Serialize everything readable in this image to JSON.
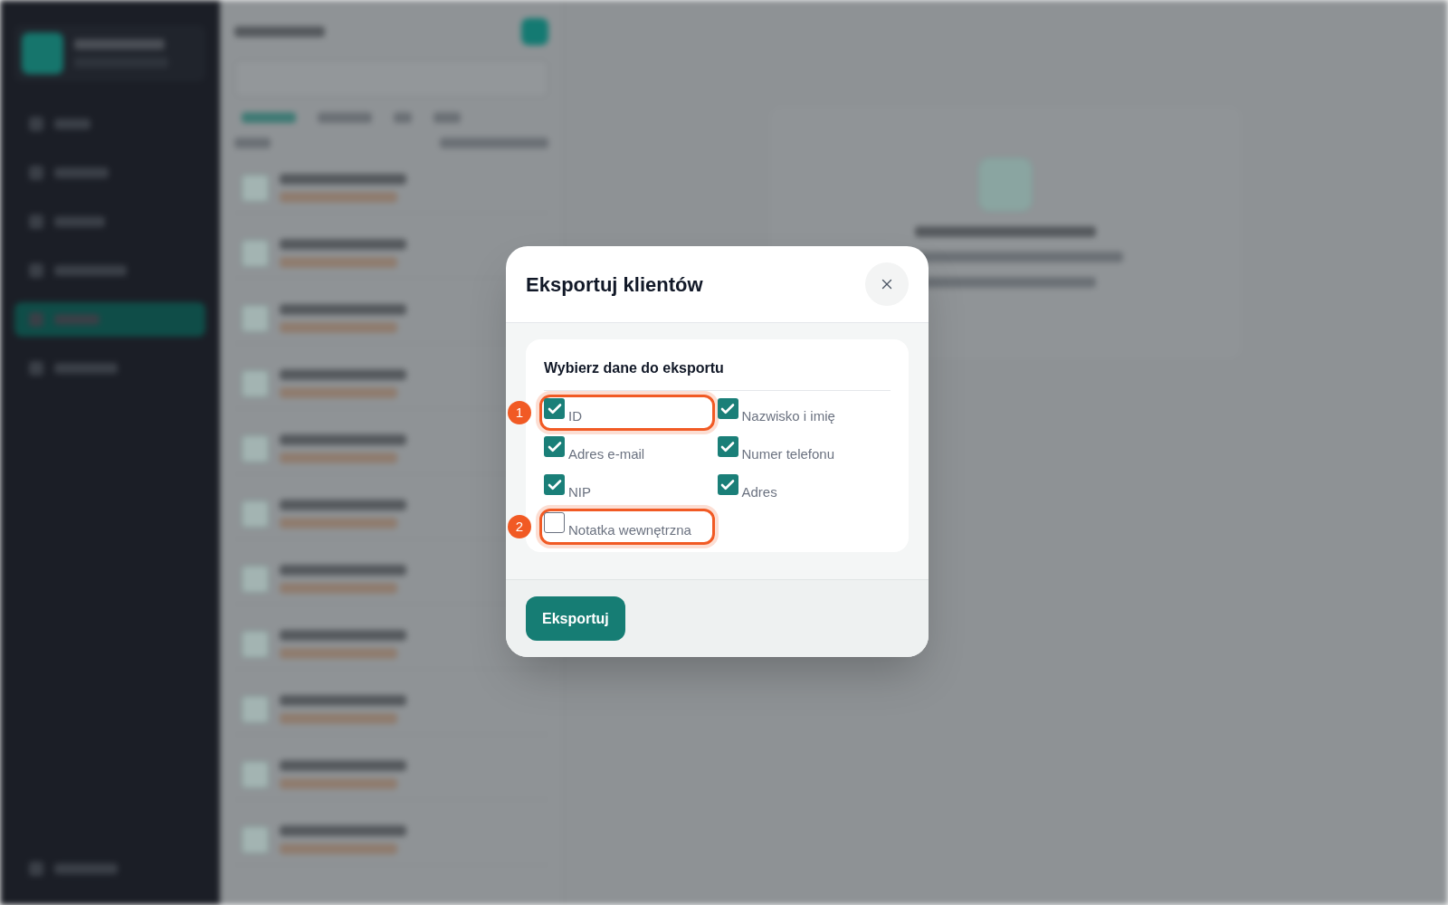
{
  "dialog": {
    "title": "Eksportuj klientów",
    "section_title": "Wybierz dane do eksportu",
    "options": [
      {
        "label": "ID",
        "checked": true,
        "marker": "1"
      },
      {
        "label": "Nazwisko i imię",
        "checked": true
      },
      {
        "label": "Adres e-mail",
        "checked": true
      },
      {
        "label": "Numer telefonu",
        "checked": true
      },
      {
        "label": "NIP",
        "checked": true
      },
      {
        "label": "Adres",
        "checked": true
      },
      {
        "label": "Notatka wewnętrzna",
        "checked": false,
        "marker": "2"
      }
    ],
    "button": "Eksportuj"
  }
}
